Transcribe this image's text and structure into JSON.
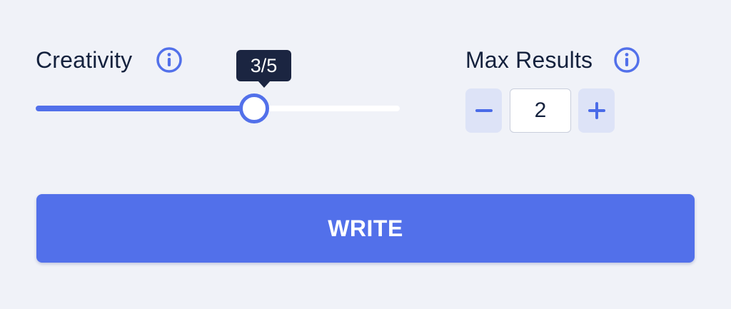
{
  "creativity": {
    "label": "Creativity",
    "tooltip": "3/5",
    "value": 3,
    "max": 5,
    "info_icon": "info-icon"
  },
  "max_results": {
    "label": "Max Results",
    "value": "2",
    "decrement_icon": "minus-icon",
    "increment_icon": "plus-icon",
    "info_icon": "info-icon"
  },
  "write_button": {
    "label": "WRITE"
  },
  "colors": {
    "accent": "#5270ea",
    "background": "#f0f2f8",
    "text": "#14213d",
    "tooltip_bg": "#1b2541",
    "stepper_bg": "#dde3f7"
  }
}
